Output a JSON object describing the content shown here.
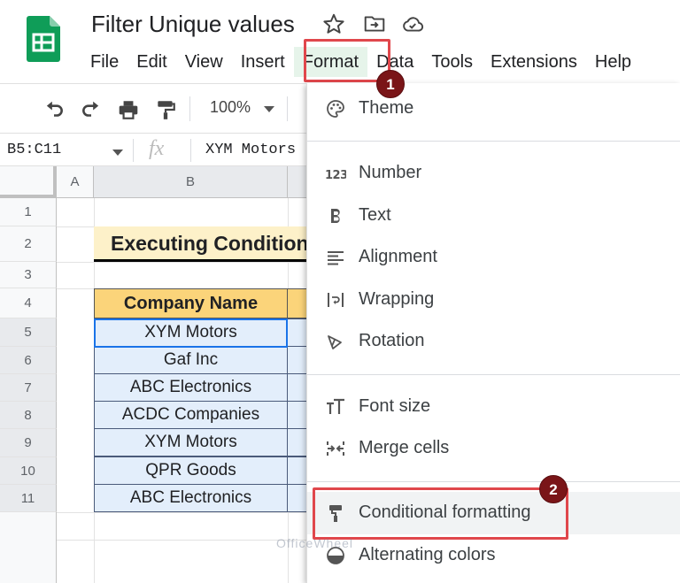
{
  "app": {
    "doc_title": "Filter Unique values",
    "menu": [
      "File",
      "Edit",
      "View",
      "Insert",
      "Format",
      "Data",
      "Tools",
      "Extensions",
      "Help"
    ],
    "active_menu": "Format"
  },
  "toolbar": {
    "zoom": "100%"
  },
  "formula_bar": {
    "name_box": "B5:C11",
    "fx": "fx",
    "value": "XYM Motors"
  },
  "grid": {
    "columns": [
      "A",
      "B"
    ],
    "rows": [
      "1",
      "2",
      "3",
      "4",
      "5",
      "6",
      "7",
      "8",
      "9",
      "10",
      "11"
    ],
    "title": "Executing Conditional Formatting",
    "table_header": "Company Name",
    "companies": [
      "XYM Motors",
      "Gaf Inc",
      "ABC Electronics",
      "ACDC Companies",
      "XYM Motors",
      "QPR Goods",
      "ABC Electronics"
    ]
  },
  "format_menu": {
    "items": [
      {
        "label": "Theme",
        "icon": "palette-icon"
      },
      {
        "label": "Number",
        "icon": "number-format-icon"
      },
      {
        "label": "Text",
        "icon": "bold-icon"
      },
      {
        "label": "Alignment",
        "icon": "align-icon"
      },
      {
        "label": "Wrapping",
        "icon": "wrap-icon"
      },
      {
        "label": "Rotation",
        "icon": "rotation-icon"
      },
      {
        "label": "Font size",
        "icon": "font-size-icon"
      },
      {
        "label": "Merge cells",
        "icon": "merge-icon"
      },
      {
        "label": "Conditional formatting",
        "icon": "paint-roller-icon"
      },
      {
        "label": "Alternating colors",
        "icon": "alternating-colors-icon"
      }
    ]
  },
  "annotations": {
    "step1": "1",
    "step2": "2"
  },
  "watermark": "OfficeWheel",
  "colors": {
    "accent": "#1a73e8",
    "highlight_border": "#e0474c",
    "badge": "#7a1518",
    "header_fill": "#fbd47a",
    "title_fill": "#fdf1c9",
    "cell_fill": "#e3eefb"
  }
}
